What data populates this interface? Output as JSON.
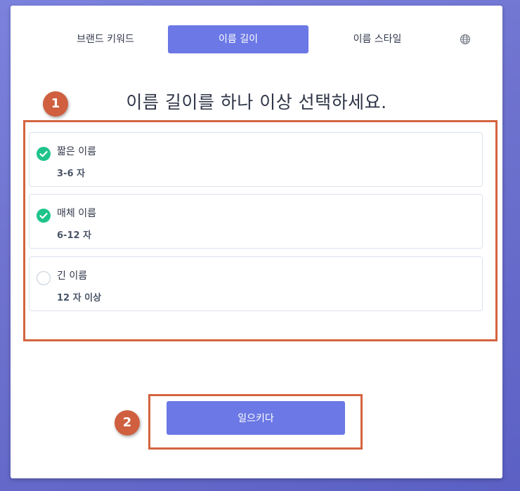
{
  "tabs": {
    "brand_keyword": "브랜드 키워드",
    "name_length": "이름 길이",
    "name_style": "이름 스타일"
  },
  "title": "이름 길이를 하나 이상 선택하세요.",
  "options": [
    {
      "name": "짧은 이름",
      "sub": "3-6 자",
      "checked": true
    },
    {
      "name": "매체 이름",
      "sub": "6-12 자",
      "checked": true
    },
    {
      "name": "긴 이름",
      "sub": "12 자 이상",
      "checked": false
    }
  ],
  "submit_label": "일으키다",
  "annotations": {
    "badge1": "1",
    "badge2": "2"
  },
  "colors": {
    "accent": "#6b78e5",
    "check_green": "#1fc48b",
    "annotation_red": "#d4643f"
  },
  "icons": {
    "language": "globe-icon",
    "selected": "check-circle-icon",
    "unselected": "empty-circle-icon"
  }
}
